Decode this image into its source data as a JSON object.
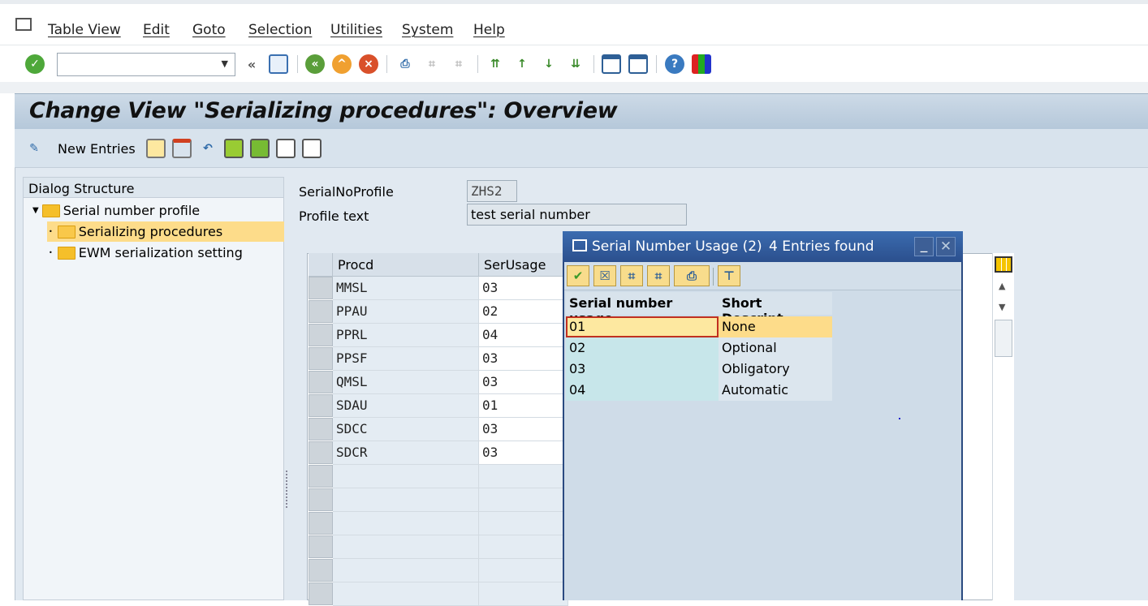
{
  "menubar": {
    "items": [
      "Table View",
      "Edit",
      "Goto",
      "Selection",
      "Utilities",
      "System",
      "Help"
    ]
  },
  "system_toolbar": {
    "command_field": {
      "value": "",
      "placeholder": ""
    },
    "icons": [
      "enter-icon",
      "save-icon",
      "back-icon",
      "exit-icon",
      "cancel-icon",
      "print-icon",
      "find-icon",
      "find-next-icon",
      "first-page-icon",
      "previous-page-icon",
      "next-page-icon",
      "last-page-icon",
      "create-session-icon",
      "shortcut-icon",
      "help-icon",
      "customize-layout-icon"
    ]
  },
  "title": "Change View \"Serializing procedures\": Overview",
  "app_toolbar": {
    "new_entries": "New Entries",
    "icons": [
      "display-change-icon",
      "copy-as-icon",
      "delete-icon",
      "undo-icon",
      "select-all-icon",
      "select-block-icon",
      "deselect-all-icon",
      "variants-icon"
    ]
  },
  "dialog_structure": {
    "header": "Dialog Structure",
    "items": [
      {
        "label": "Serial number profile",
        "level": 0,
        "expanded": true
      },
      {
        "label": "Serializing procedures",
        "level": 1,
        "selected": true
      },
      {
        "label": "EWM serialization setting",
        "level": 1
      }
    ]
  },
  "header_fields": {
    "profile_label": "SerialNoProfile",
    "profile_value": "ZHS2",
    "text_label": "Profile text",
    "text_value": "test serial number"
  },
  "table": {
    "columns": [
      "Procd",
      "SerUsage"
    ],
    "rows": [
      [
        "MMSL",
        "03"
      ],
      [
        "PPAU",
        "02"
      ],
      [
        "PPRL",
        "04"
      ],
      [
        "PPSF",
        "03"
      ],
      [
        "QMSL",
        "03"
      ],
      [
        "SDAU",
        "01"
      ],
      [
        "SDCC",
        "03"
      ],
      [
        "SDCR",
        "03"
      ]
    ]
  },
  "popup": {
    "title": "Serial Number Usage (2)",
    "count": "4 Entries found",
    "columns": [
      "Serial number usage",
      "Short Descript."
    ],
    "rows": [
      [
        "01",
        "None"
      ],
      [
        "02",
        "Optional"
      ],
      [
        "03",
        "Obligatory"
      ],
      [
        "04",
        "Automatic"
      ]
    ],
    "selected_index": 0
  },
  "colors": {
    "popup_title": "#2b4f8d",
    "selection": "#fddc8a",
    "tree_selected": "#fddc8a"
  }
}
